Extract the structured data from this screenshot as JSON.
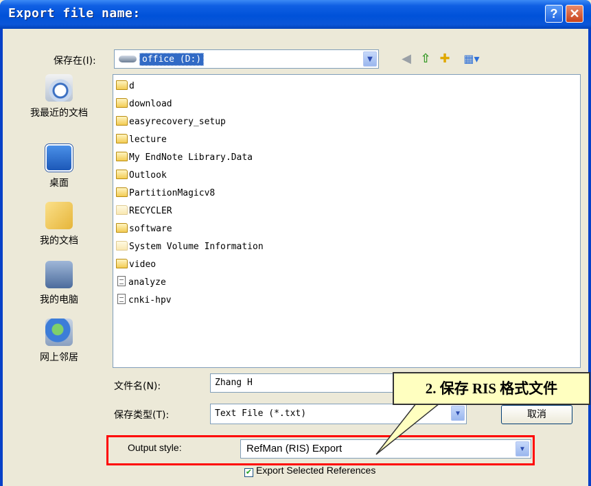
{
  "window": {
    "title": "Export file name:",
    "help_label": "?",
    "close_label": "✕"
  },
  "toolbar": {
    "save_in_label": "保存在(I):",
    "save_in_value": "office (D:)",
    "icons": [
      "back-icon",
      "up-folder-icon",
      "new-folder-icon",
      "views-menu-icon"
    ]
  },
  "places": [
    {
      "label": "我最近的文档",
      "icon": "recent-documents-icon"
    },
    {
      "label": "桌面",
      "icon": "desktop-icon"
    },
    {
      "label": "我的文档",
      "icon": "my-documents-icon"
    },
    {
      "label": "我的电脑",
      "icon": "my-computer-icon"
    },
    {
      "label": "网上邻居",
      "icon": "network-places-icon"
    }
  ],
  "files": [
    {
      "name": "d",
      "type": "folder"
    },
    {
      "name": "download",
      "type": "folder"
    },
    {
      "name": "easyrecovery_setup",
      "type": "folder"
    },
    {
      "name": "lecture",
      "type": "folder"
    },
    {
      "name": "My EndNote Library.Data",
      "type": "folder"
    },
    {
      "name": "Outlook",
      "type": "folder"
    },
    {
      "name": "PartitionMagicv8",
      "type": "folder"
    },
    {
      "name": "RECYCLER",
      "type": "hidden-folder"
    },
    {
      "name": "software",
      "type": "folder"
    },
    {
      "name": "System Volume Information",
      "type": "hidden-folder"
    },
    {
      "name": "video",
      "type": "folder"
    },
    {
      "name": "analyze",
      "type": "document"
    },
    {
      "name": "cnki-hpv",
      "type": "document"
    }
  ],
  "form": {
    "filename_label": "文件名(N):",
    "filename_value": "Zhang H",
    "filetype_label": "保存类型(T):",
    "filetype_value": "Text File (*.txt)",
    "cancel_label": "取消"
  },
  "output": {
    "label": "Output style:",
    "value": "RefMan (RIS) Export",
    "export_selected_label": "Export Selected References",
    "export_selected_checked": true
  },
  "callout": {
    "text": "2. 保存 RIS 格式文件"
  },
  "colors": {
    "titlebar": "#0052d9",
    "highlight": "#316ac5",
    "annotation_border": "#ff0000",
    "callout_fill": "#ffffc0"
  }
}
